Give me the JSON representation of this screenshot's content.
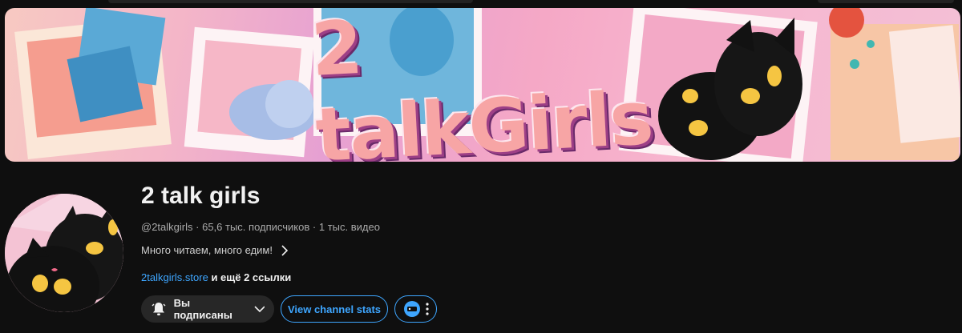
{
  "banner": {
    "title": "2 talkGirls"
  },
  "channel": {
    "name": "2 talk girls",
    "handle": "@2talkgirls",
    "subscribers": "65,6 тыс. подписчиков",
    "videos": "1 тыс. видео",
    "separator": "·",
    "description": "Много читаем, много едим!",
    "link_text": "2talkgirls.store",
    "more_links": "и ещё 2 ссылки"
  },
  "actions": {
    "subscribed_label": "Вы подписаны",
    "stats_label": "View channel stats"
  },
  "colors": {
    "accent": "#3ea6ff",
    "background": "#0f0f0f",
    "button_bg": "#272727"
  },
  "icons": [
    "bell-icon",
    "chevron-down-icon",
    "chevron-right-icon",
    "extension-icon",
    "more-vert-icon"
  ]
}
